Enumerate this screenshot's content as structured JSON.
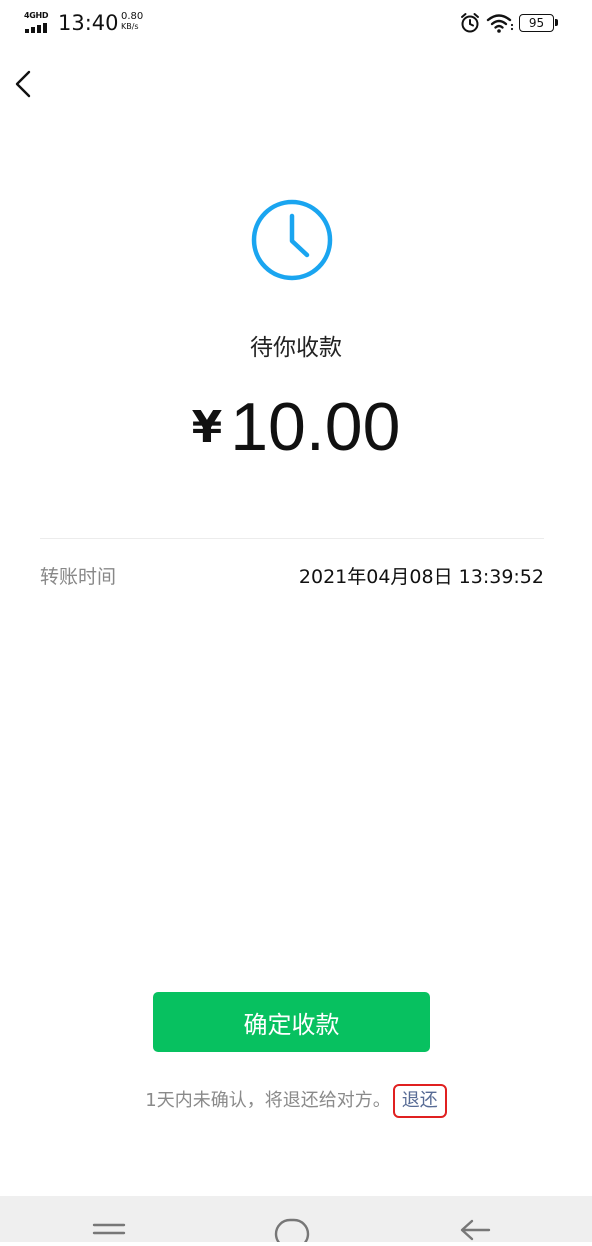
{
  "status_bar": {
    "network": "4GHD",
    "time": "13:40",
    "speed": "0.80",
    "speed_unit": "KB/s",
    "battery": "95",
    "icons": [
      "signal-icon",
      "alarm-icon",
      "wifi-icon",
      "battery-icon"
    ]
  },
  "navigation": {
    "back_icon": "chevron-left-icon"
  },
  "transfer": {
    "status_icon": "clock-icon",
    "status": "待你收款",
    "currency_symbol": "¥",
    "amount": "10.00",
    "time_label": "转账时间",
    "time_value": "2021年04月08日 13:39:52"
  },
  "actions": {
    "confirm_label": "确定收款",
    "note_text": "1天内未确认，将退还给对方。",
    "refund_label": "退还"
  },
  "system_nav": {
    "icons": [
      "menu-icon",
      "home-icon",
      "back-arrow-icon"
    ]
  },
  "colors": {
    "accent_green": "#07C160",
    "clock_blue": "#1AA5F0",
    "link_blue": "#576B95",
    "highlight_red": "#E02020"
  }
}
